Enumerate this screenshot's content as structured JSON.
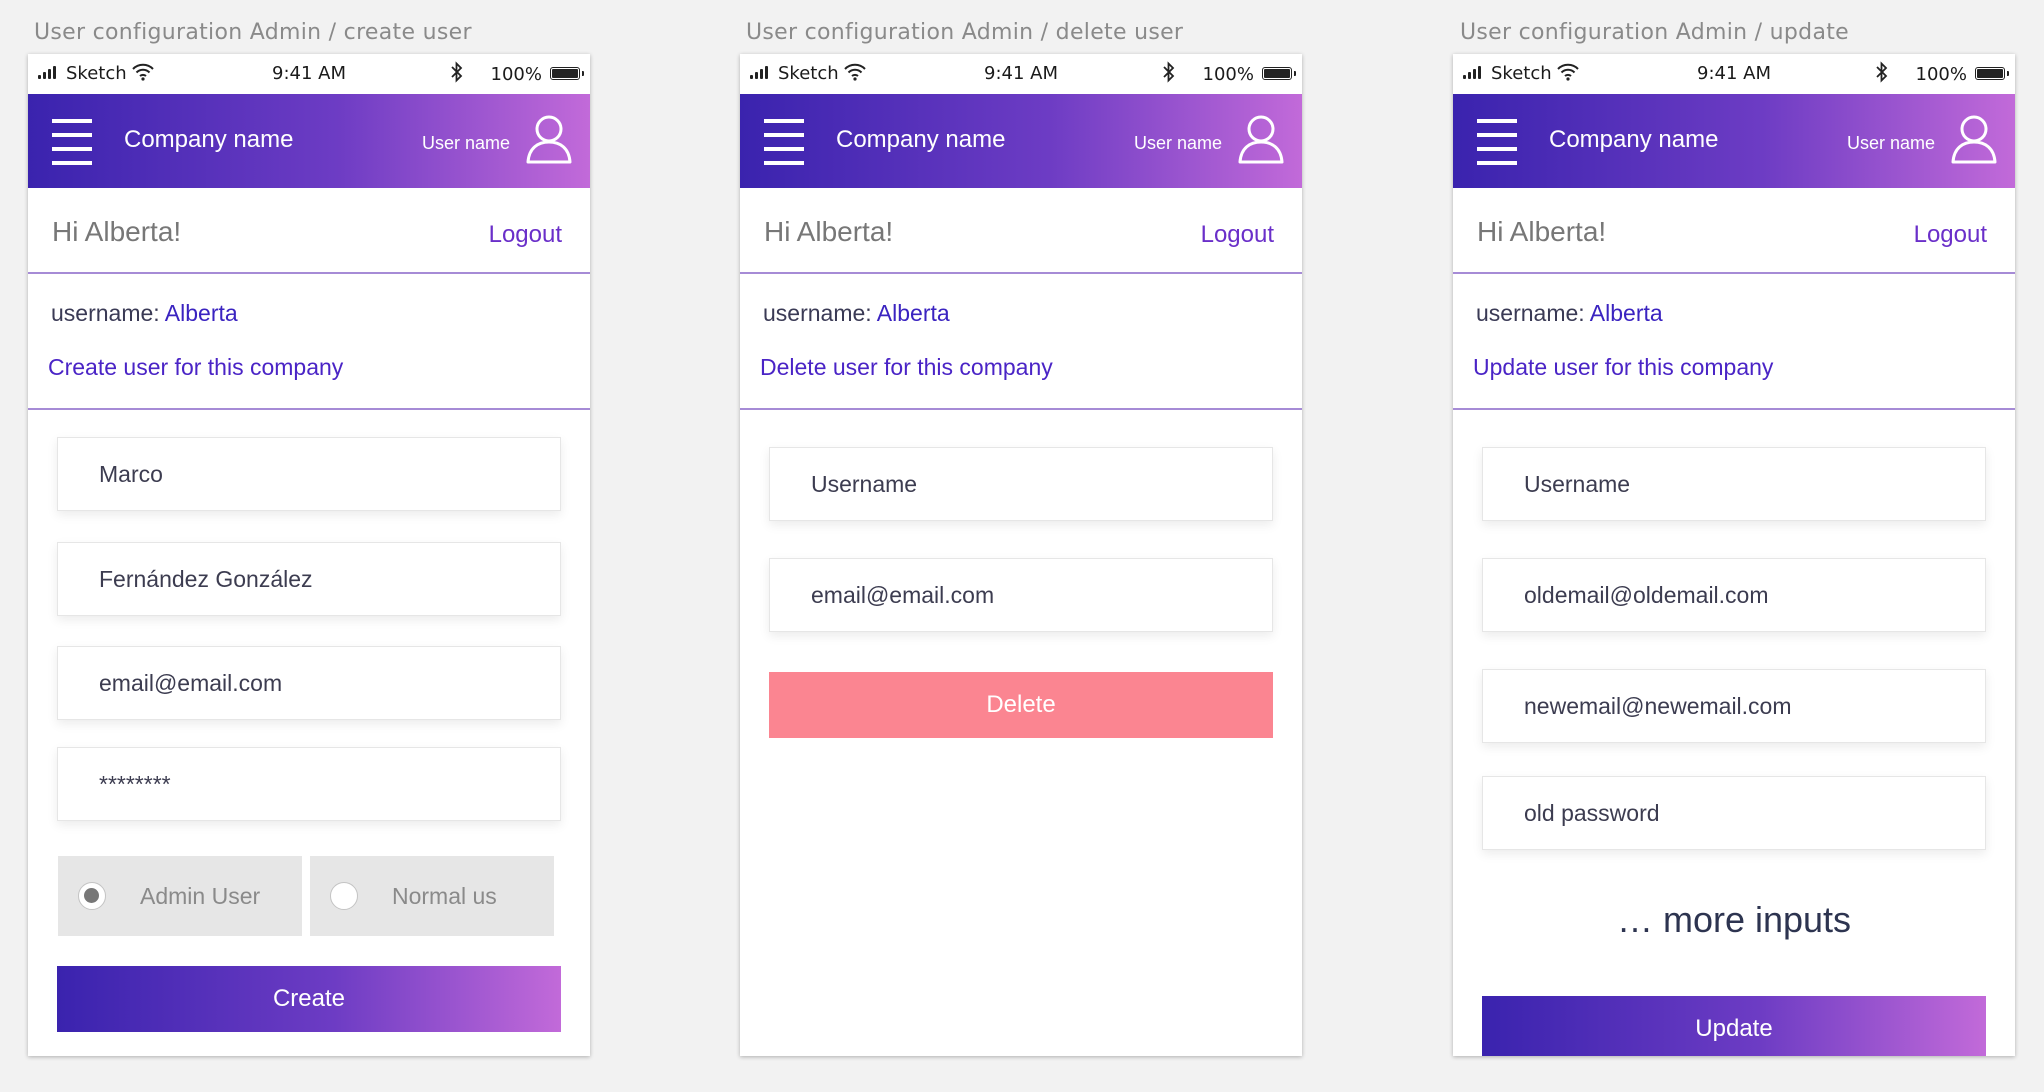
{
  "artboards": [
    {
      "title": "User configuration Admin / create user",
      "status": {
        "carrier": "Sketch",
        "time": "9:41 AM",
        "battery": "100%"
      },
      "header": {
        "company": "Company name",
        "user": "User name"
      },
      "greeting": "Hi Alberta!",
      "logout": "Logout",
      "username_label": "username: ",
      "username_value": "Alberta",
      "action": "Create user for this company",
      "fields": [
        "Marco",
        "Fernández González",
        "email@email.com",
        "********"
      ],
      "radios": [
        {
          "label": "Admin User",
          "checked": true
        },
        {
          "label": "Normal us",
          "checked": false
        }
      ],
      "button": "Create"
    },
    {
      "title": "User configuration Admin / delete user",
      "status": {
        "carrier": "Sketch",
        "time": "9:41 AM",
        "battery": "100%"
      },
      "header": {
        "company": "Company name",
        "user": "User name"
      },
      "greeting": "Hi Alberta!",
      "logout": "Logout",
      "username_label": "username: ",
      "username_value": "Alberta",
      "action": "Delete user for this company",
      "fields": [
        "Username",
        "email@email.com"
      ],
      "button": "Delete"
    },
    {
      "title": "User configuration Admin / update",
      "status": {
        "carrier": "Sketch",
        "time": "9:41 AM",
        "battery": "100%"
      },
      "header": {
        "company": "Company name",
        "user": "User name"
      },
      "greeting": "Hi Alberta!",
      "logout": "Logout",
      "username_label": "username: ",
      "username_value": "Alberta",
      "action": "Update user for this company",
      "fields": [
        "Username",
        "oldemail@oldemail.com",
        "newemail@newemail.com",
        "old password"
      ],
      "more_inputs": "… more inputs",
      "button": "Update"
    }
  ],
  "colors": {
    "gradient_start": "#3a23ae",
    "gradient_end": "#c26ad9",
    "accent_link": "#4a24c6",
    "danger": "#fb8591",
    "divider": "#a68bd6"
  }
}
